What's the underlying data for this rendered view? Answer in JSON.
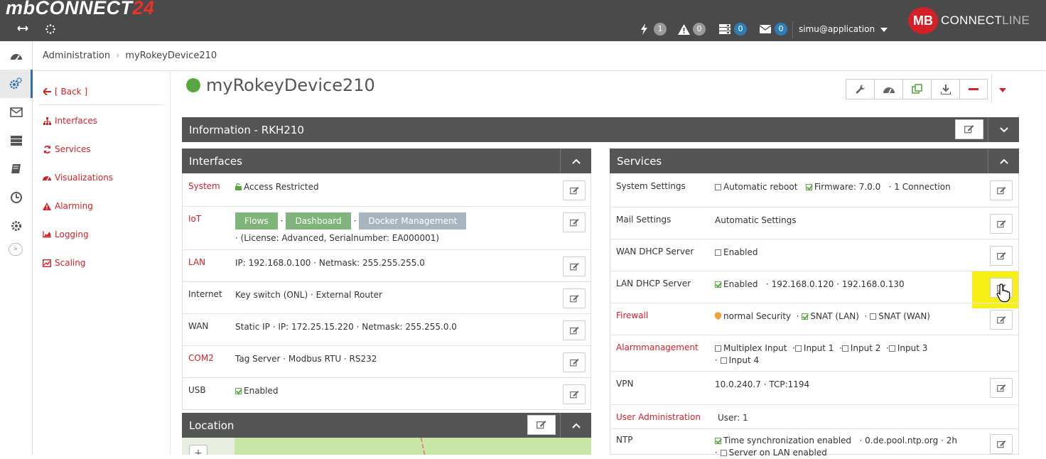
{
  "app": {
    "logo_main": "mbCONNECT",
    "logo_accent": "24",
    "brand_badge": "MB",
    "brand_connect": "CONNECT",
    "brand_line": "LINE",
    "user_label": "simu@application"
  },
  "toolbar": {
    "notifications": [
      {
        "icon": "lightning-icon",
        "count": "1",
        "color": "#999999"
      },
      {
        "icon": "warning-icon",
        "count": "0",
        "color": "#999999"
      },
      {
        "icon": "server-icon",
        "count": "0",
        "color": "#2f7db7"
      },
      {
        "icon": "envelope-icon",
        "count": "0",
        "color": "#2f7db7"
      }
    ]
  },
  "breadcrumb": {
    "root": "Administration",
    "current": "myRokeyDevice210"
  },
  "submenu": {
    "back": "[ Back ]",
    "items": [
      "Interfaces",
      "Services",
      "Visualizations",
      "Alarming",
      "Logging",
      "Scaling"
    ]
  },
  "device": {
    "name": "myRokeyDevice210",
    "status_color": "#5aa645"
  },
  "info_panel": {
    "title": "Information - RKH210"
  },
  "interfaces": {
    "title": "Interfaces",
    "rows": {
      "system": {
        "key": "System",
        "value": "Access Restricted"
      },
      "iot": {
        "key": "IoT",
        "flows": "Flows",
        "dashboard": "Dashboard",
        "docker": "Docker Management",
        "license": "· (License: Advanced, Serialnumber: EA000001)"
      },
      "lan": {
        "key": "LAN",
        "value": "IP: 192.168.0.100   · Netmask: 255.255.255.0"
      },
      "internet": {
        "key": "Internet",
        "value": "Key switch (ONL)   · External Router"
      },
      "wan": {
        "key": "WAN",
        "value": "Static IP   · IP: 172.25.15.220   · Netmask: 255.255.0.0"
      },
      "com2": {
        "key": "COM2",
        "value": "Tag Server   · Modbus RTU   · RS232"
      },
      "usb": {
        "key": "USB",
        "value": "Enabled"
      }
    }
  },
  "location": {
    "title": "Location",
    "zoom_in": "+"
  },
  "services": {
    "title": "Services",
    "rows": {
      "system_settings": {
        "key": "System Settings",
        "auto_reboot": "Automatic reboot",
        "firmware": "Firmware: 7.0.0",
        "connection": "· 1 Connection"
      },
      "mail_settings": {
        "key": "Mail Settings",
        "value": "Automatic Settings"
      },
      "wan_dhcp": {
        "key": "WAN DHCP Server",
        "value": "Enabled"
      },
      "lan_dhcp": {
        "key": "LAN DHCP Server",
        "enabled": "Enabled",
        "range": "· 192.168.0.120   · 192.168.0.130"
      },
      "firewall": {
        "key": "Firewall",
        "security": "normal Security",
        "snat_lan": "SNAT (LAN)",
        "snat_wan": "SNAT (WAN)"
      },
      "alarm": {
        "key": "Alarmmanagement",
        "multiplex": "Multiplex Input",
        "input1": "Input 1",
        "input2": "Input 2",
        "input3": "Input 3",
        "input4": "Input 4"
      },
      "vpn": {
        "key": "VPN",
        "value": "10.0.240.7   · TCP:1194"
      },
      "user_admin": {
        "key": "User Administration",
        "value": "User: 1"
      },
      "ntp": {
        "key": "NTP",
        "sync": "Time synchronization enabled",
        "pool": "· 0.de.pool.ntp.org   · 2h",
        "server_lan": "Server on LAN enabled"
      }
    }
  }
}
